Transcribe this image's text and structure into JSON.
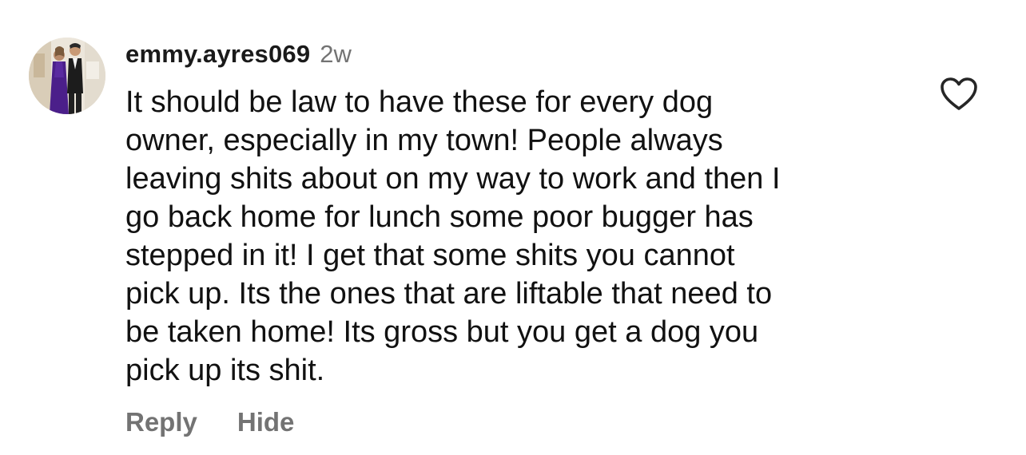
{
  "comment": {
    "username": "emmy.ayres069",
    "timestamp": "2w",
    "text_lines": [
      "It should be law to have these for every dog",
      "owner, especially in my town! People always",
      "leaving shits about on my way to work and then I",
      "go back home for lunch some poor bugger has",
      "stepped in it! I get that some shits you cannot",
      "pick up. Its the ones that are liftable that need to",
      "be taken home! Its gross but you get a dog you",
      "pick up its shit."
    ],
    "actions": {
      "reply_label": "Reply",
      "hide_label": "Hide"
    },
    "like_icon": "heart-outline-icon",
    "colors": {
      "text": "#111111",
      "secondary": "#737373",
      "background": "#ffffff"
    }
  }
}
